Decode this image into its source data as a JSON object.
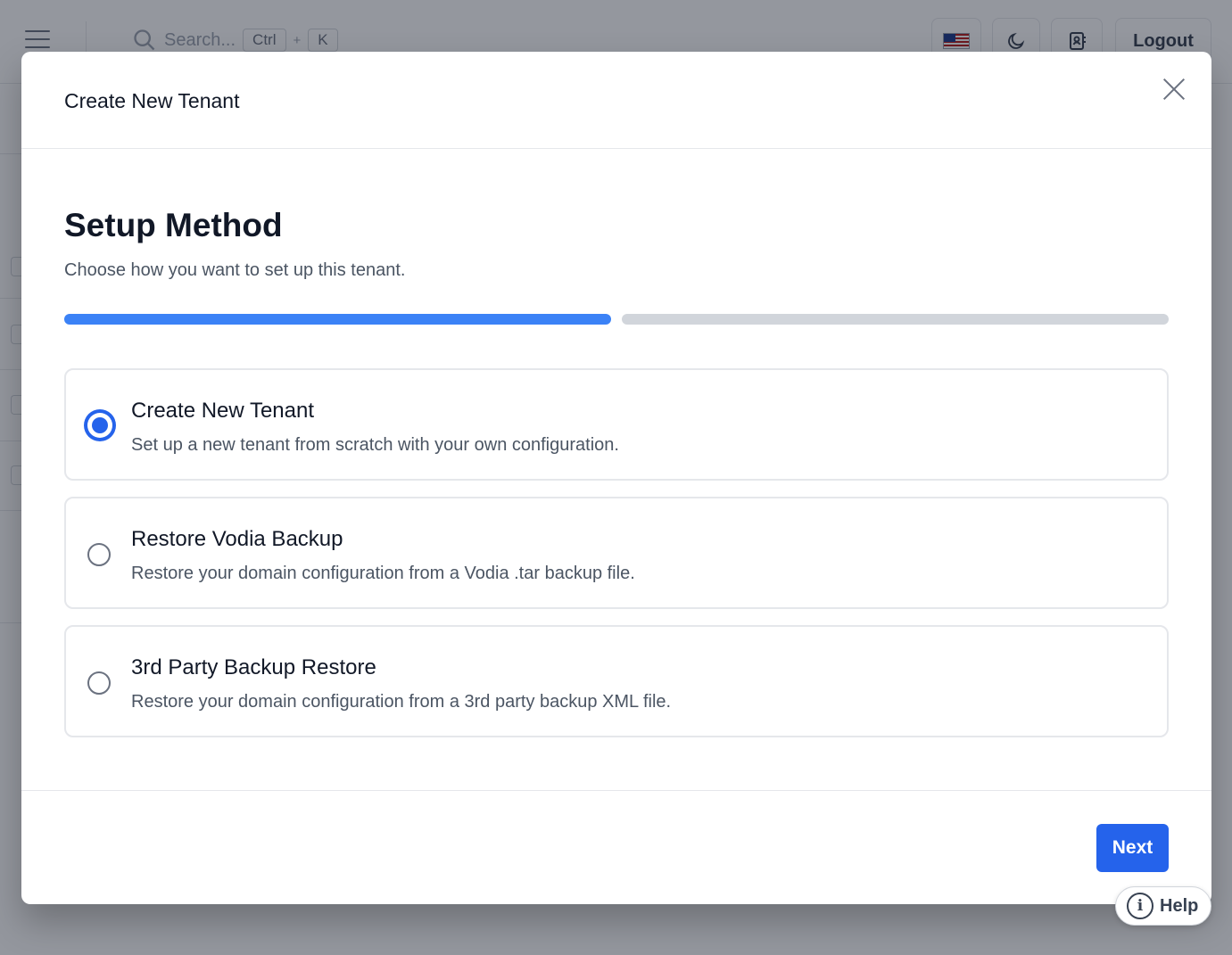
{
  "header": {
    "search_placeholder": "Search...",
    "shortcut_key1": "Ctrl",
    "shortcut_plus": "+",
    "shortcut_key2": "K",
    "logout_label": "Logout"
  },
  "modal": {
    "title": "Create New Tenant",
    "step_title": "Setup Method",
    "step_subtitle": "Choose how you want to set up this tenant.",
    "progress": {
      "current_step": 1,
      "total_steps": 2
    },
    "options": [
      {
        "title": "Create New Tenant",
        "description": "Set up a new tenant from scratch with your own configuration.",
        "selected": true
      },
      {
        "title": "Restore Vodia Backup",
        "description": "Restore your domain configuration from a Vodia .tar backup file.",
        "selected": false
      },
      {
        "title": "3rd Party Backup Restore",
        "description": "Restore your domain configuration from a 3rd party backup XML file.",
        "selected": false
      }
    ],
    "next_label": "Next"
  },
  "help": {
    "label": "Help"
  },
  "colors": {
    "primary": "#2563eb",
    "progress_active": "#3b82f6",
    "progress_inactive": "#d1d5db",
    "overlay": "rgba(17,24,39,0.45)"
  }
}
